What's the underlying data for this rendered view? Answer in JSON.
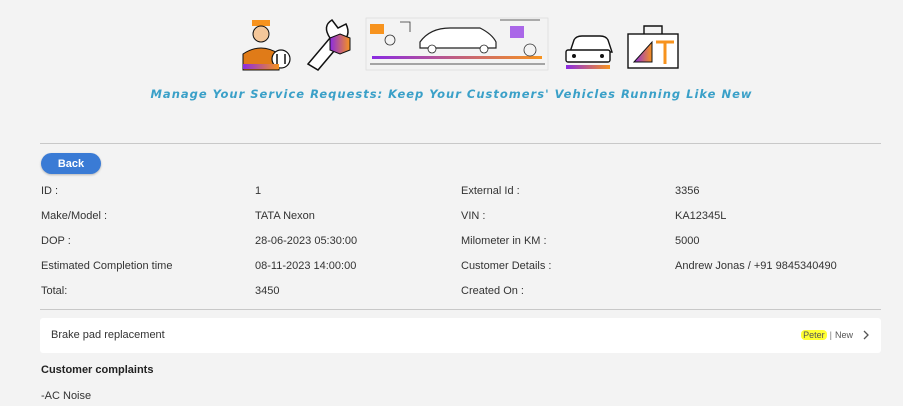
{
  "banner": {
    "icons": [
      "mechanic-icon",
      "wrench-hexagon-icon",
      "garage-workshop-icon",
      "car-icon",
      "toolbox-icon"
    ]
  },
  "tagline": "Manage Your Service Requests: Keep Your Customers' Vehicles Running Like New",
  "back_label": "Back",
  "details": {
    "id_label": "ID :",
    "id_value": "1",
    "external_id_label": "External Id :",
    "external_id_value": "3356",
    "make_label": "Make/Model :",
    "make_value": "TATA Nexon",
    "vin_label": "VIN :",
    "vin_value": "KA12345L",
    "dop_label": "DOP :",
    "dop_value": "28-06-2023 05:30:00",
    "milometer_label": "Milometer in KM :",
    "milometer_value": "5000",
    "eta_label": "Estimated Completion time",
    "eta_value": "08-11-2023 14:00:00",
    "customer_label": "Customer Details :",
    "customer_value": "Andrew Jonas / +91 9845340490",
    "total_label": "Total:",
    "total_value": "3450",
    "created_label": "Created On :",
    "created_value": ""
  },
  "service_item": {
    "title": "Brake pad replacement",
    "assignee": "Peter",
    "separator": "|",
    "status": "New"
  },
  "complaints": {
    "title": "Customer complaints",
    "items": [
      "-AC Noise"
    ]
  },
  "colors": {
    "accent_blue": "#3a7bd5",
    "tagline": "#3aa0c8",
    "highlight": "#ffff33",
    "icon_gradient_purple": "#8a2be2",
    "icon_gradient_orange": "#f7931e"
  }
}
